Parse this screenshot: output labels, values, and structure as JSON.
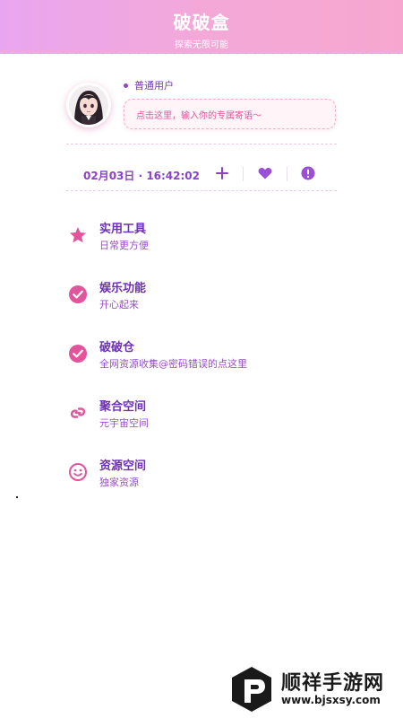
{
  "header": {
    "title": "破破盒",
    "subtitle": "探索无限可能"
  },
  "profile": {
    "avatar_icon": "anime-avatar",
    "user_type": "普通用户",
    "motto_placeholder": "点击这里，输入你的专属寄语～"
  },
  "datebar": {
    "datetime": "02月03日 · 16:42:02",
    "icons": [
      "plus-icon",
      "heart-icon",
      "alert-icon"
    ]
  },
  "menu": [
    {
      "title": "实用工具",
      "subtitle": "日常更方便",
      "icon": "star-icon"
    },
    {
      "title": "娱乐功能",
      "subtitle": "开心起来",
      "icon": "check-circle-icon"
    },
    {
      "title": "破破仓",
      "subtitle": "全网资源收集@密码错误的点这里",
      "icon": "check-circle-icon"
    },
    {
      "title": "聚合空间",
      "subtitle": "元宇宙空间",
      "icon": "link-icon"
    },
    {
      "title": "资源空间",
      "subtitle": "独家资源",
      "icon": "smile-icon"
    }
  ],
  "watermark": {
    "name": "顺祥手游网",
    "url": "www.bjsxsy.com"
  },
  "colors": {
    "header_start": "#e9a6f0",
    "header_end": "#f7a7cf",
    "accent_purple": "#8a42c9",
    "accent_pink": "#e0559b"
  }
}
